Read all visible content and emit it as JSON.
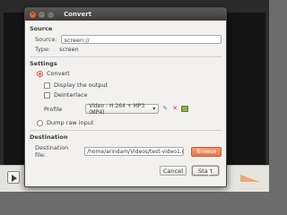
{
  "dialog": {
    "title": "Convert",
    "source": {
      "heading": "Source",
      "source_label": "Source:",
      "source_value": "screen://",
      "type_label": "Type:",
      "type_value": "screen"
    },
    "settings": {
      "heading": "Settings",
      "convert_label": "Convert",
      "convert_selected": true,
      "display_output_label": "Display the output",
      "display_output_checked": false,
      "deinterlace_label": "Deinterlace",
      "deinterlace_checked": false,
      "profile_label": "Profile",
      "profile_value": "Video - H.264 + MP3 (MP4)",
      "dump_raw_label": "Dump raw input",
      "dump_raw_selected": false
    },
    "destination": {
      "heading": "Destination",
      "file_label": "Destination file:",
      "file_value": "/home/arindam/Videos/test-video1.mp4",
      "browse_label": "Browse"
    },
    "buttons": {
      "cancel": "Cancel",
      "start": "Start"
    }
  },
  "player": {
    "time": "--:--"
  },
  "colors": {
    "accent": "#e8643a",
    "titlebar": "#3d3c39",
    "dialog_bg": "#f2f1f0"
  },
  "icons": [
    "close-icon",
    "minimize-icon",
    "maximize-icon",
    "wrench-icon",
    "delete-icon",
    "add-profile-icon",
    "play-icon",
    "volume-icon",
    "dropdown-arrow-icon"
  ]
}
